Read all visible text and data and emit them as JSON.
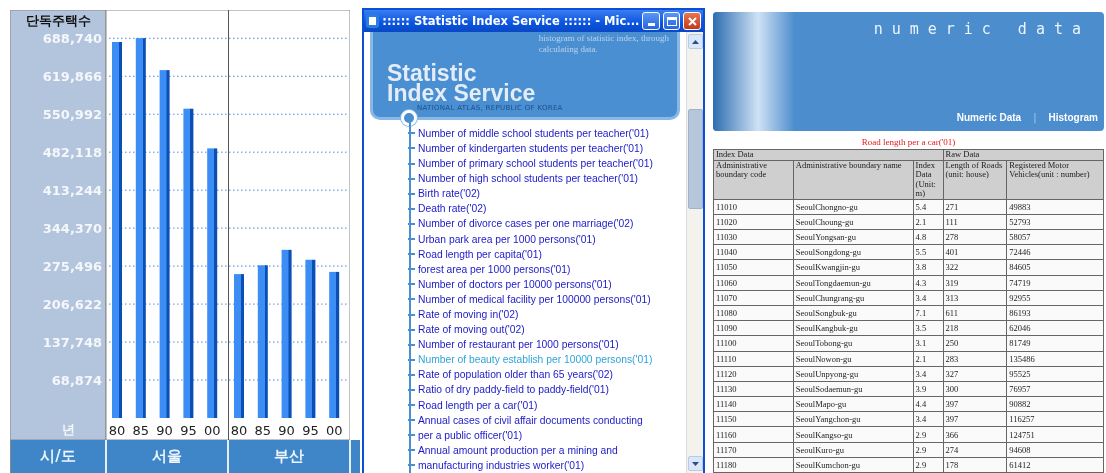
{
  "chart_panel": {
    "year_label": "년",
    "region_label": "시/도",
    "regions": [
      "서울",
      "부산"
    ],
    "chart_data": {
      "type": "bar",
      "ylabel": "단독주택수",
      "categories": [
        "80",
        "85",
        "90",
        "95",
        "00",
        "80",
        "85",
        "90",
        "95",
        "00"
      ],
      "values": [
        682000,
        689000,
        631000,
        561000,
        489000,
        261000,
        277000,
        305000,
        287000,
        265000
      ],
      "ylim": [
        0,
        740000
      ],
      "grid": true,
      "yticks": [
        {
          "value": 68874,
          "label": "68,874"
        },
        {
          "value": 137748,
          "label": "137,748"
        },
        {
          "value": 206622,
          "label": "206,622"
        },
        {
          "value": 275496,
          "label": "275,496"
        },
        {
          "value": 344370,
          "label": "344,370"
        },
        {
          "value": 413244,
          "label": "413,244"
        },
        {
          "value": 482118,
          "label": "482,118"
        },
        {
          "value": 550992,
          "label": "550,992"
        },
        {
          "value": 619866,
          "label": "619,866"
        },
        {
          "value": 688740,
          "label": "688,740"
        }
      ]
    }
  },
  "browser_window": {
    "title": ":::::: Statistic Index Service :::::: - Mic...",
    "banner": {
      "intro_lines": [
        "histogram of statistic index, through",
        "calculating data."
      ],
      "title_lines": [
        "Statistic",
        "Index Service"
      ],
      "subtitle": "NATIONAL ATLAS, REPUBLIC OF KOREA"
    },
    "index_links": [
      {
        "label": "Number of middle school students per teacher('01)",
        "selected": false
      },
      {
        "label": "Number of kindergarten students per teacher('01)",
        "selected": false
      },
      {
        "label": "Number of primary school students per teacher('01)",
        "selected": false
      },
      {
        "label": "Number of high school students per teacher('01)",
        "selected": false
      },
      {
        "label": "Birth rate('02)",
        "selected": false
      },
      {
        "label": "Death rate('02)",
        "selected": false
      },
      {
        "label": "Number of divorce cases per one marriage('02)",
        "selected": false
      },
      {
        "label": "Urban park area per 1000 persons('01)",
        "selected": false
      },
      {
        "label": "Road length per capita('01)",
        "selected": false
      },
      {
        "label": "forest area per 1000 persons('01)",
        "selected": false
      },
      {
        "label": "Number of doctors per 10000 persons('01)",
        "selected": false
      },
      {
        "label": "Number of medical facility per 100000 persons('01)",
        "selected": false
      },
      {
        "label": "Rate of moving in('02)",
        "selected": false
      },
      {
        "label": "Rate of moving out('02)",
        "selected": false
      },
      {
        "label": "Number of restaurant per 1000 persons('01)",
        "selected": false
      },
      {
        "label": "Number of beauty establish per 10000 persons('01)",
        "selected": true
      },
      {
        "label": "Rate of population older than 65 years('02)",
        "selected": false
      },
      {
        "label": "Ratio of dry paddy-field to paddy-field('01)",
        "selected": false
      },
      {
        "label": "Road length per a car('01)",
        "selected": false
      },
      {
        "label": "Annual cases of civil affair documents conducting",
        "selected": false
      },
      {
        "label": "per a public officer('01)",
        "selected": false
      },
      {
        "label": "Annual amount production per a mining and",
        "selected": false
      },
      {
        "label": "manufacturing industries worker('01)",
        "selected": false
      }
    ]
  },
  "numeric_data_page": {
    "logo": "numeric data",
    "nav": [
      "Numeric Data",
      "Histogram"
    ],
    "nav_separator": "|",
    "table_title": "Road length per a car('01)",
    "column_groups": [
      {
        "label": "Index Data",
        "columns": [
          "Administrative boundary code",
          "Administrative boundary name",
          "Index Data (Unit: m)"
        ]
      },
      {
        "label": "Raw Data",
        "columns": [
          "Length of Roads (unit: house)",
          "Registered Motor Vehicles(unit : number)"
        ]
      }
    ],
    "rows": [
      [
        "11010",
        "SeoulChongno-gu",
        "5.4",
        "271",
        "49883"
      ],
      [
        "11020",
        "SeoulChoung-gu",
        "2.1",
        "111",
        "52793"
      ],
      [
        "11030",
        "SeoulYongsan-gu",
        "4.8",
        "278",
        "58057"
      ],
      [
        "11040",
        "SeoulSongdong-gu",
        "5.5",
        "401",
        "72446"
      ],
      [
        "11050",
        "SeoulKwangjin-gu",
        "3.8",
        "322",
        "84605"
      ],
      [
        "11060",
        "SeoulTongdaemun-gu",
        "4.3",
        "319",
        "74719"
      ],
      [
        "11070",
        "SeoulChungrang-gu",
        "3.4",
        "313",
        "92955"
      ],
      [
        "11080",
        "SeoulSongbuk-gu",
        "7.1",
        "611",
        "86193"
      ],
      [
        "11090",
        "SeoulKangbuk-gu",
        "3.5",
        "218",
        "62046"
      ],
      [
        "11100",
        "SeoulTobong-gu",
        "3.1",
        "250",
        "81749"
      ],
      [
        "11110",
        "SeoulNowon-gu",
        "2.1",
        "283",
        "135486"
      ],
      [
        "11120",
        "SeoulUnpyong-gu",
        "3.4",
        "327",
        "95525"
      ],
      [
        "11130",
        "SeoulSodaemun-gu",
        "3.9",
        "300",
        "76957"
      ],
      [
        "11140",
        "SeoulMapo-gu",
        "4.4",
        "397",
        "90882"
      ],
      [
        "11150",
        "SeoulYangchon-gu",
        "3.4",
        "397",
        "116257"
      ],
      [
        "11160",
        "SeoulKangso-gu",
        "2.9",
        "366",
        "124751"
      ],
      [
        "11170",
        "SeoulKuro-gu",
        "2.9",
        "274",
        "94608"
      ],
      [
        "11180",
        "SeoulKumchon-gu",
        "2.9",
        "178",
        "61412"
      ]
    ]
  }
}
